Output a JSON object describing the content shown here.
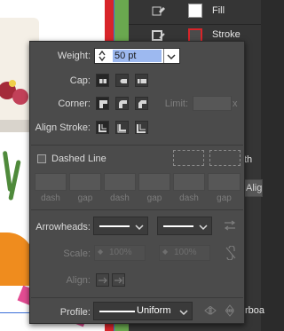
{
  "panel": {
    "fill_label": "Fill",
    "stroke_label": "Stroke",
    "partial_text_1": "th",
    "partial_text_2": "Alig",
    "partial_text_3": "rboa"
  },
  "stroke_popup": {
    "weight_label": "Weight:",
    "weight_value": "50 pt",
    "cap_label": "Cap:",
    "corner_label": "Corner:",
    "limit_label": "Limit:",
    "limit_unit": "x",
    "align_stroke_label": "Align Stroke:",
    "dashed_line_label": "Dashed Line",
    "dash_labels": [
      "dash",
      "gap",
      "dash",
      "gap",
      "dash",
      "gap"
    ],
    "arrowheads_label": "Arrowheads:",
    "scale_label": "Scale:",
    "scale_start": "100%",
    "scale_end": "100%",
    "align_label": "Align:",
    "profile_label": "Profile:",
    "profile_value": "Uniform"
  },
  "colors": {
    "panel_bg": "#4b4b4b",
    "selection": "#9db9f0",
    "stroke_swatch": "#d8252a"
  }
}
